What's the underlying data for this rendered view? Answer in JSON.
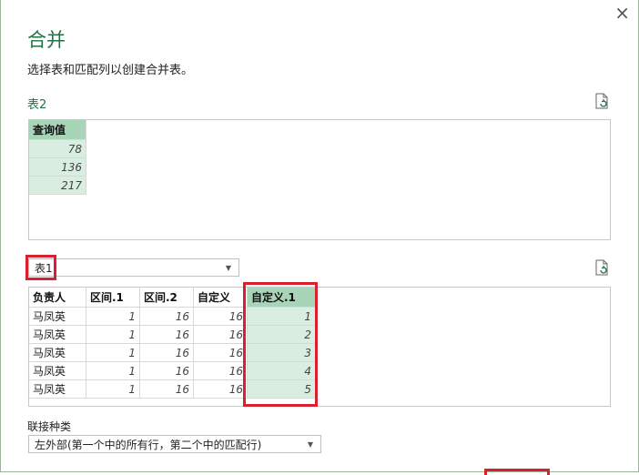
{
  "dialog": {
    "close_label": "×",
    "title": "合并",
    "subtitle": "选择表和匹配列以创建合并表。"
  },
  "table2": {
    "label": "表2",
    "header": "查询值",
    "rows": [
      "78",
      "136",
      "217"
    ]
  },
  "table1": {
    "selector_value": "表1",
    "columns": [
      "负责人",
      "区间.1",
      "区间.2",
      "自定义",
      "自定义.1"
    ],
    "rows": [
      [
        "马凤英",
        "1",
        "16",
        "16",
        "1"
      ],
      [
        "马凤英",
        "1",
        "16",
        "16",
        "2"
      ],
      [
        "马凤英",
        "1",
        "16",
        "16",
        "3"
      ],
      [
        "马凤英",
        "1",
        "16",
        "16",
        "4"
      ],
      [
        "马凤英",
        "1",
        "16",
        "16",
        "5"
      ]
    ]
  },
  "join": {
    "label": "联接种类",
    "selected": "左外部(第一个中的所有行，第二个中的匹配行)"
  },
  "icons": {
    "refresh": "refresh-icon",
    "dropdown_arrow": "chevron-down-icon"
  },
  "colors": {
    "accent": "#217346",
    "selected_column": "#d9eee1",
    "highlight": "#d8202f"
  }
}
